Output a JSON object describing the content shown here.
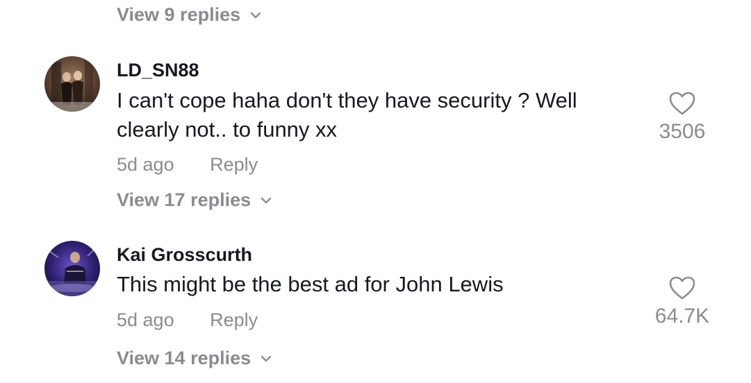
{
  "top_thread": {
    "view_replies_label": "View 9 replies"
  },
  "comments": [
    {
      "username": "LD_SN88",
      "text": "I can't cope haha don't they have security ? Well clearly not.. to funny xx",
      "time": "5d ago",
      "reply_label": "Reply",
      "likes": "3506",
      "view_replies_label": "View 17 replies",
      "avatar_icon": "user-avatar-photo",
      "avatar_colors": [
        "#3a2a22",
        "#8a6a52"
      ]
    },
    {
      "username": "Kai Grosscurth",
      "text": "This might be the best ad for John Lewis",
      "time": "5d ago",
      "reply_label": "Reply",
      "likes": "64.7K",
      "view_replies_label": "View 14 replies",
      "avatar_icon": "user-avatar-photo",
      "avatar_colors": [
        "#1b1440",
        "#5b3fb0"
      ]
    }
  ],
  "icons": {
    "like": "heart-outline-icon",
    "expand": "chevron-down-icon"
  },
  "colors": {
    "primary_text": "#161823",
    "secondary_text": "#8a8b91",
    "background": "#ffffff"
  }
}
